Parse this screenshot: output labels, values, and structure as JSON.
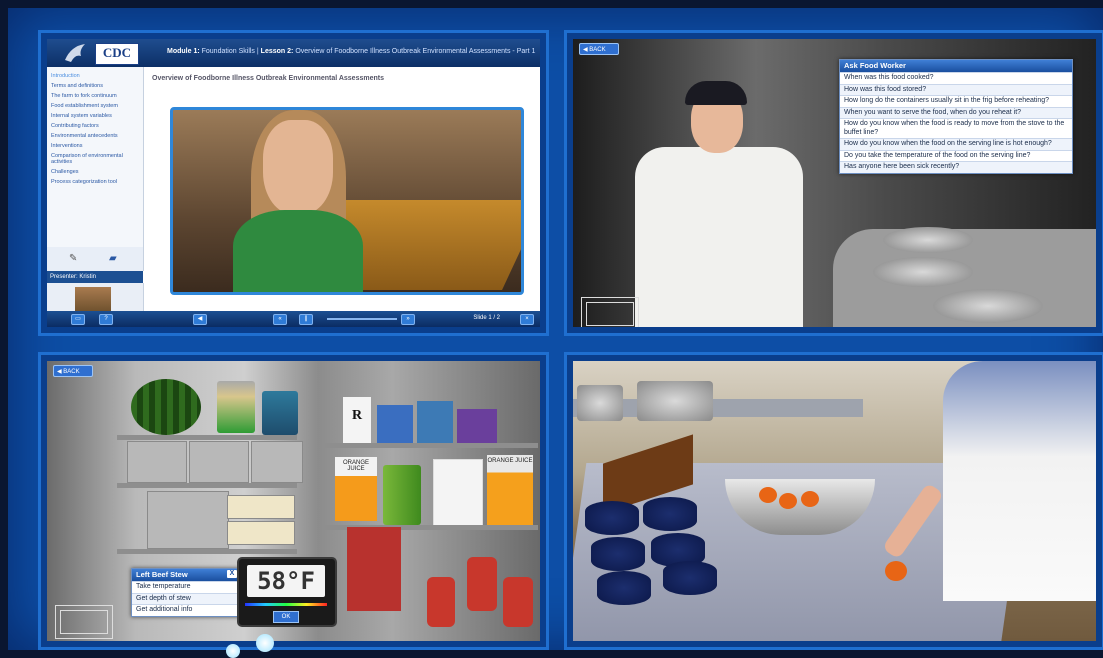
{
  "course_player": {
    "logo_text": "CDC",
    "breadcrumb_module": "Module 1:",
    "breadcrumb_module_name": "Foundation Skills",
    "breadcrumb_sep": "|",
    "breadcrumb_lesson": "Lesson 2:",
    "breadcrumb_lesson_name": "Overview of Foodborne Illness Outbreak Environmental Assessments - Part 1",
    "content_title": "Overview of Foodborne Illness Outbreak Environmental Assessments",
    "toc": [
      "Introduction",
      "Terms and definitions",
      "The farm to fork continuum",
      "Food establishment system",
      "Internal system variables",
      "Contributing factors",
      "Environmental antecedents",
      "Interventions",
      "Comparison of environmental activities",
      "Challenges",
      "Process categorization tool"
    ],
    "presenter_label": "Presenter: Kristin",
    "slide_counter": "Slide 1 / 2"
  },
  "food_worker": {
    "back_label": "BACK",
    "menu_title": "Ask Food Worker",
    "questions": [
      "When was this food cooked?",
      "How was this food stored?",
      "How long do the containers usually sit in the frig before reheating?",
      "When you want to serve the food, when do you reheat it?",
      "How do you know when the food is ready to move from the stove to the buffet line?",
      "How do you know when the food on the serving line is hot enough?",
      "Do you take the temperature of the food on the serving line?",
      "Has anyone here been sick recently?"
    ]
  },
  "fridge": {
    "back_label": "BACK",
    "menu_title": "Left Beef Stew",
    "close_label": "X",
    "actions": [
      "Take temperature",
      "Get depth of stew",
      "Get additional info"
    ],
    "temperature_reading": "58°F",
    "ok_label": "OK",
    "juice_label": "ORANGE JUICE",
    "brand_label": "R"
  },
  "colors": {
    "frame": "#0d4ea6",
    "panel_border": "#1f6fd0",
    "menu_header": "#1a4f9f",
    "accent_button": "#2f6fd0"
  }
}
